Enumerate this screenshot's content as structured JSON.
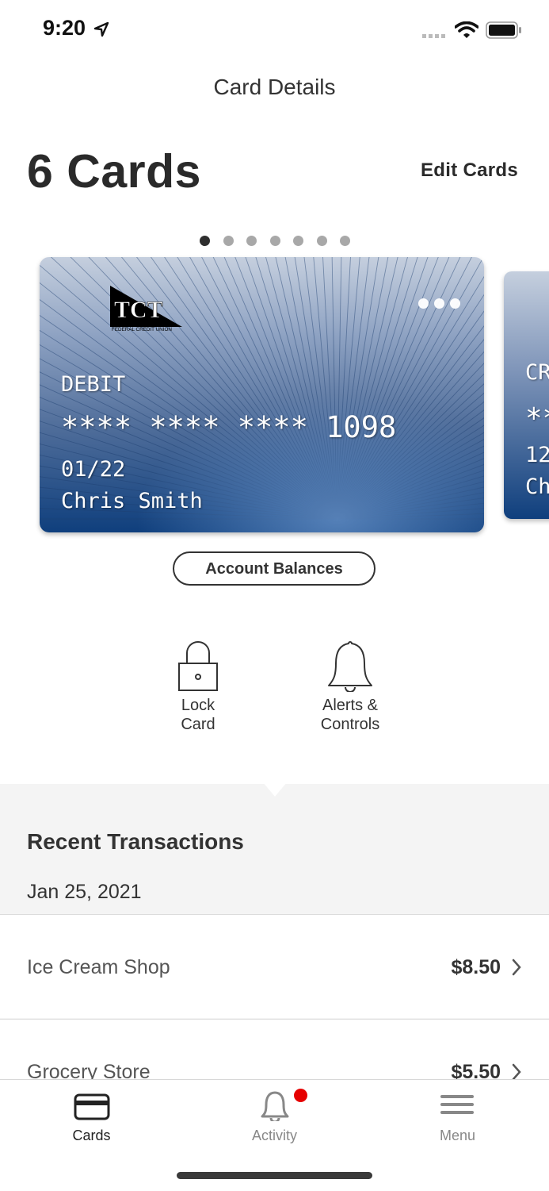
{
  "status_bar": {
    "time": "9:20"
  },
  "header": {
    "title": "Card Details"
  },
  "cards_summary": {
    "count_label": "6 Cards",
    "edit_label": "Edit Cards",
    "page_count": 7,
    "active_page": 0
  },
  "card": {
    "type": "DEBIT",
    "number": "**** **** **** 1098",
    "expiry": "01/22",
    "holder": "Chris Smith",
    "issuer_logo_text": "TCT FEDERAL CREDIT UNION"
  },
  "next_card": {
    "type_partial": "CR",
    "number_partial": "**",
    "expiry_partial": "12",
    "holder_partial": "Ch"
  },
  "account_balances_label": "Account Balances",
  "actions": [
    {
      "label_line1": "Lock",
      "label_line2": "Card",
      "icon": "lock-icon"
    },
    {
      "label_line1": "Alerts &",
      "label_line2": "Controls",
      "icon": "bell-icon"
    }
  ],
  "transactions": {
    "heading": "Recent Transactions",
    "date": "Jan 25, 2021",
    "items": [
      {
        "name": "Ice Cream Shop",
        "amount": "$8.50"
      },
      {
        "name": "Grocery Store",
        "amount": "$5.50"
      }
    ]
  },
  "tabs": [
    {
      "label": "Cards",
      "icon": "card-icon",
      "active": true
    },
    {
      "label": "Activity",
      "icon": "bell-icon",
      "badge": true
    },
    {
      "label": "Menu",
      "icon": "hamburger-icon"
    }
  ],
  "colors": {
    "accent": "#333333",
    "badge": "#e60000",
    "card_dark": "#0f3f7d",
    "card_light": "#c5cfde"
  }
}
